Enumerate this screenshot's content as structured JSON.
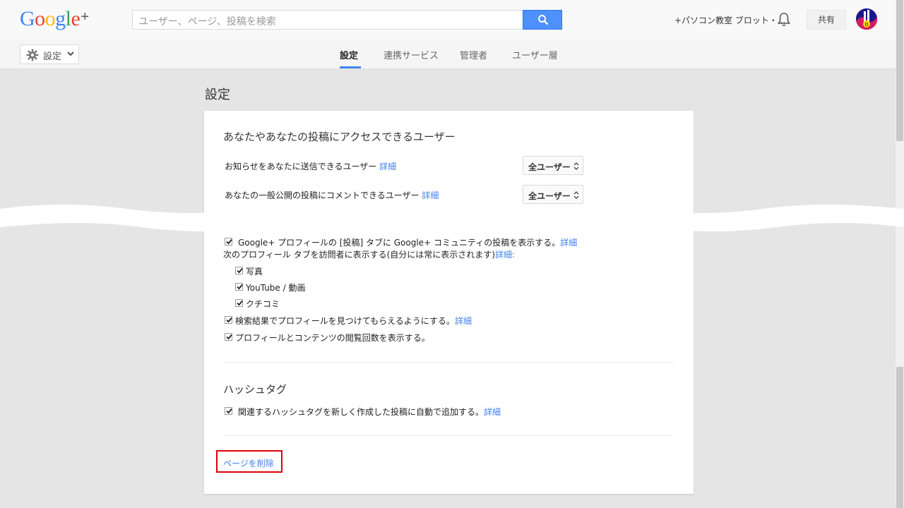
{
  "header": {
    "logo_text": "Google",
    "logo_plus": "+",
    "search_placeholder": "ユーザー、ページ、投稿を検索",
    "account_name": "+パソコン教室 ブロット・...",
    "share_label": "共有"
  },
  "subnav": {
    "settings_label": "設定",
    "tabs": [
      {
        "label": "設定"
      },
      {
        "label": "連携サービス"
      },
      {
        "label": "管理者"
      },
      {
        "label": "ユーザー層"
      }
    ]
  },
  "main": {
    "page_title": "設定",
    "access_section": {
      "title": "あなたやあなたの投稿にアクセスできるユーザー",
      "rows": [
        {
          "label": "お知らせをあなたに送信できるユーザー",
          "link": "詳細",
          "value": "全ユーザー"
        },
        {
          "label": "あなたの一般公開の投稿にコメントできるユーザー",
          "link": "詳細",
          "value": "全ユーザー"
        }
      ]
    },
    "profile_section": {
      "community_tab": {
        "label": "Google+ プロフィールの [投稿] タブに Google+ コミュニティの投稿を表示する。",
        "link": "詳細"
      },
      "visible_tabs_label": "次のプロフィール タブを訪問者に表示する(自分には常に表示されます)",
      "visible_tabs_link": "詳細:",
      "tabs": [
        {
          "label": "写真"
        },
        {
          "label": "YouTube / 動画"
        },
        {
          "label": "クチコミ"
        }
      ],
      "search_option": {
        "label": "検索結果でプロフィールを見つけてもらえるようにする。",
        "link": "詳細"
      },
      "views_option": {
        "label": "プロフィールとコンテンツの閲覧回数を表示する。"
      }
    },
    "hashtag_section": {
      "title": "ハッシュタグ",
      "option": {
        "label": "関連するハッシュタグを新しく作成した投稿に自動で追加する。",
        "link": "詳細"
      }
    },
    "delete_page_label": "ページを削除"
  }
}
